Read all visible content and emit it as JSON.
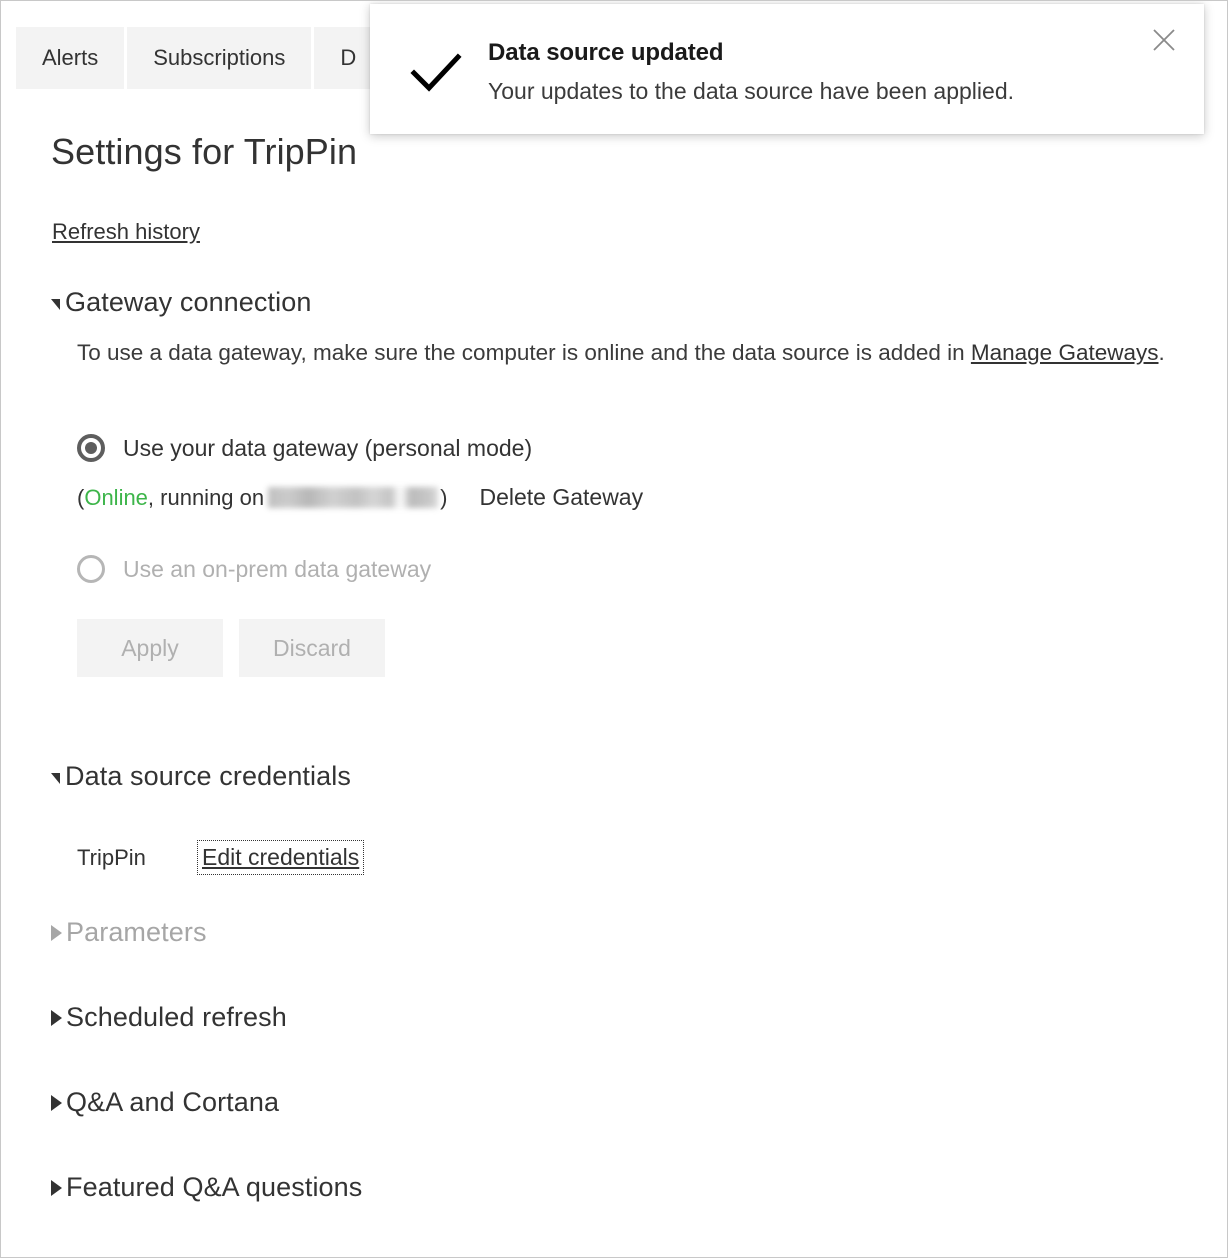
{
  "tabs": [
    {
      "label": "Alerts",
      "name": "tab-alerts"
    },
    {
      "label": "Subscriptions",
      "name": "tab-subscriptions"
    },
    {
      "label": "D",
      "name": "tab-datasets-partial"
    }
  ],
  "toast": {
    "icon": "checkmark-icon",
    "title": "Data source updated",
    "body": "Your updates to the data source have been applied.",
    "close_icon": "close-icon"
  },
  "page": {
    "title": "Settings for TripPin",
    "refresh_history_link": "Refresh history"
  },
  "gateway": {
    "heading": "Gateway connection",
    "description_before": "To use a data gateway, make sure the computer is online and the data source is added in ",
    "description_link": "Manage Gateways",
    "description_after": ".",
    "options": [
      {
        "label": "Use your data gateway (personal mode)",
        "selected": true,
        "disabled": false
      },
      {
        "label": "Use an on-prem data gateway",
        "selected": false,
        "disabled": true
      }
    ],
    "status_open_paren": "(",
    "status_state": "Online",
    "status_middle": ", running on ",
    "status_host": "",
    "status_close_paren": ")",
    "delete_link": "Delete Gateway",
    "apply_label": "Apply",
    "discard_label": "Discard"
  },
  "credentials": {
    "heading": "Data source credentials",
    "source_name": "TripPin",
    "edit_link": "Edit credentials"
  },
  "sections": [
    {
      "label": "Parameters",
      "disabled": true
    },
    {
      "label": "Scheduled refresh",
      "disabled": false
    },
    {
      "label": "Q&A and Cortana",
      "disabled": false
    },
    {
      "label": "Featured Q&A questions",
      "disabled": false
    }
  ],
  "colors": {
    "online_green": "#3db54a",
    "tab_background": "#f3f3f3",
    "text": "#333333",
    "muted_text": "#a6a6a6"
  }
}
